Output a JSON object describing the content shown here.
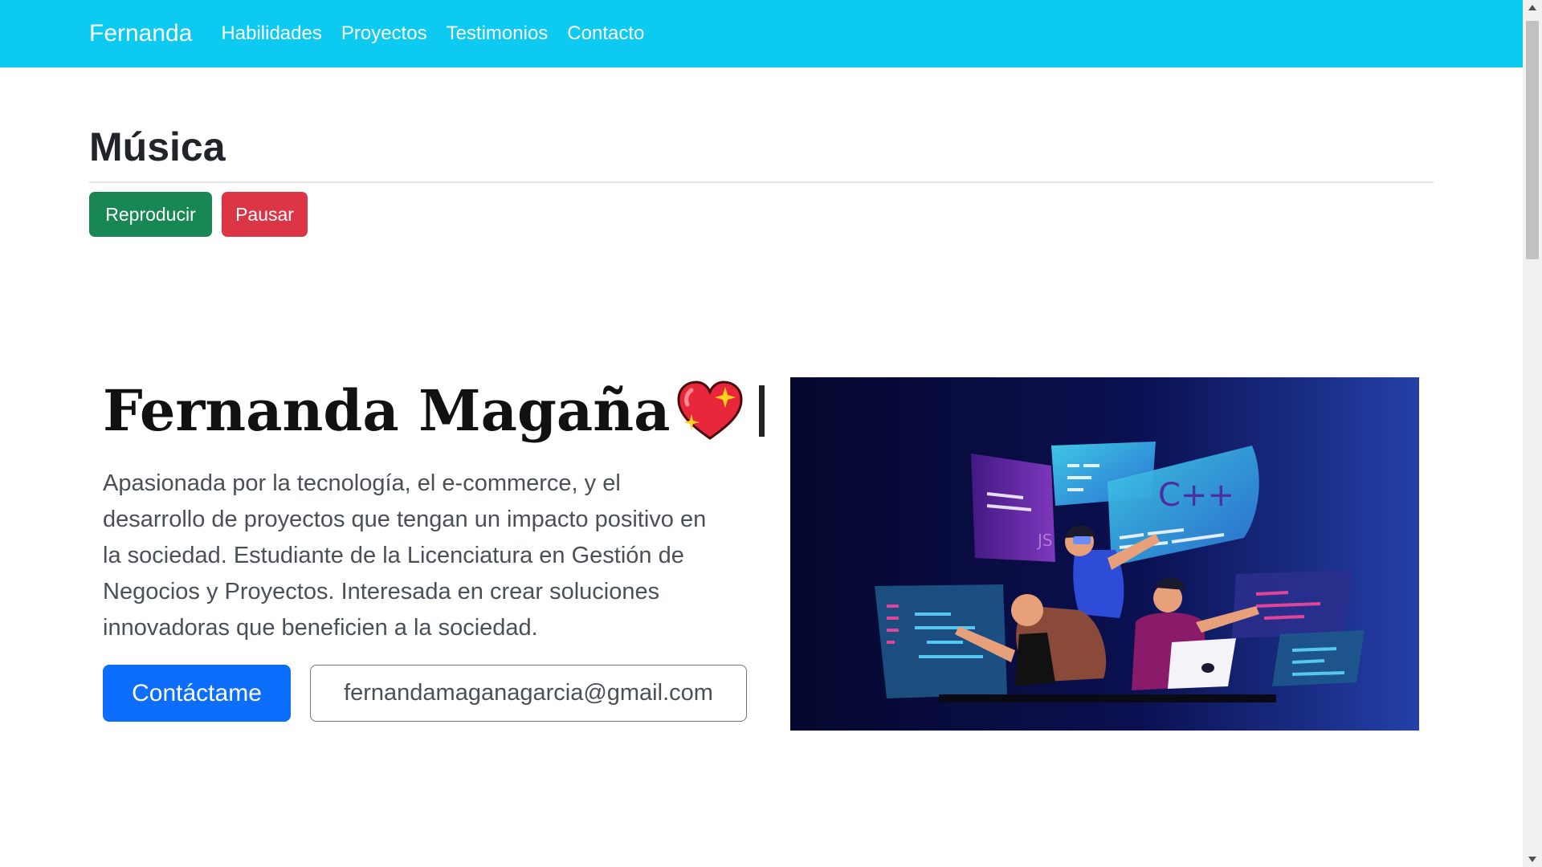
{
  "navbar": {
    "brand": "Fernanda",
    "links": [
      "Habilidades",
      "Proyectos",
      "Testimonios",
      "Contacto"
    ]
  },
  "music": {
    "title": "Música",
    "play_label": "Reproducir",
    "pause_label": "Pausar"
  },
  "hero": {
    "name": "Fernanda Magaña",
    "description": "Apasionada por la tecnología, el e-commerce, y el desarrollo de proyectos que tengan un impacto positivo en la sociedad. Estudiante de la Licenciatura en Gestión de Negocios y Proyectos. Interesada en crear soluciones innovadoras que beneficien a la sociedad.",
    "contact_label": "Contáctame",
    "email": "fernandamaganagarcia@gmail.com",
    "image_labels": {
      "js": "JS",
      "cpp": "C++"
    }
  },
  "colors": {
    "navbar": "#0dcaf0",
    "play": "#198754",
    "pause": "#dc3545",
    "contact": "#0d6efd"
  },
  "icons": [
    "sparkling-heart-icon",
    "typing-cursor-icon"
  ]
}
